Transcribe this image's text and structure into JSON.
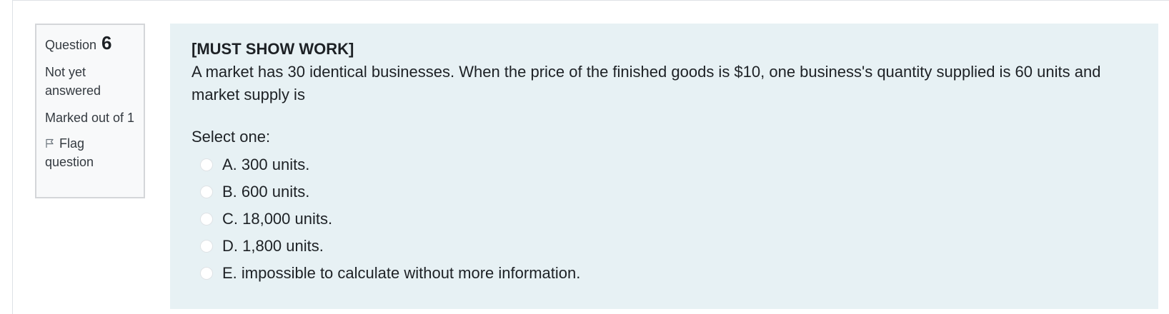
{
  "question": {
    "label": "Question",
    "number": "6",
    "state": "Not yet answered",
    "grade": "Marked out of 1",
    "flag_label": "Flag question",
    "flag_icon": "flag-outline-icon"
  },
  "content": {
    "heading": "[MUST SHOW WORK]",
    "text": "A market has 30 identical businesses. When the price of the finished goods is $10, one business's quantity supplied is 60 units and market supply is",
    "prompt": "Select one:",
    "background_color": "#e7f1f4",
    "answers": [
      {
        "label": "A. 300 units."
      },
      {
        "label": "B. 600 units."
      },
      {
        "label": "C. 18,000 units."
      },
      {
        "label": "D. 1,800 units."
      },
      {
        "label": "E. impossible to calculate without more information."
      }
    ]
  }
}
